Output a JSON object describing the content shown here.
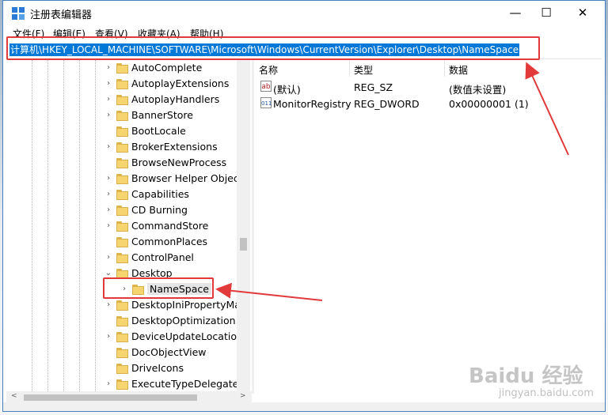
{
  "window": {
    "title": "注册表编辑器",
    "minimize_label": "—",
    "maximize_label": "☐",
    "close_label": "✕"
  },
  "menu": [
    "文件(F)",
    "编辑(E)",
    "查看(V)",
    "收藏夹(A)",
    "帮助(H)"
  ],
  "address": "计算机\\HKEY_LOCAL_MACHINE\\SOFTWARE\\Microsoft\\Windows\\CurrentVersion\\Explorer\\Desktop\\NameSpace",
  "tree": [
    {
      "label": "AutoComplete",
      "expander": ">"
    },
    {
      "label": "AutoplayExtensions",
      "expander": ">"
    },
    {
      "label": "AutoplayHandlers",
      "expander": ">"
    },
    {
      "label": "BannerStore",
      "expander": ">"
    },
    {
      "label": "BootLocale",
      "expander": ""
    },
    {
      "label": "BrokerExtensions",
      "expander": ">"
    },
    {
      "label": "BrowseNewProcess",
      "expander": ""
    },
    {
      "label": "Browser Helper Object",
      "expander": ">"
    },
    {
      "label": "Capabilities",
      "expander": ">"
    },
    {
      "label": "CD Burning",
      "expander": ">"
    },
    {
      "label": "CommandStore",
      "expander": ">"
    },
    {
      "label": "CommonPlaces",
      "expander": ""
    },
    {
      "label": "ControlPanel",
      "expander": ">"
    },
    {
      "label": "Desktop",
      "expander": "v"
    },
    {
      "label": "NameSpace",
      "expander": ">"
    },
    {
      "label": "DesktopIniPropertyMa",
      "expander": ">"
    },
    {
      "label": "DesktopOptimization",
      "expander": ""
    },
    {
      "label": "DeviceUpdateLocations",
      "expander": ">"
    },
    {
      "label": "DocObjectView",
      "expander": ""
    },
    {
      "label": "DriveIcons",
      "expander": ""
    },
    {
      "label": "ExecuteTypeDelegates",
      "expander": ">"
    }
  ],
  "list": {
    "headers": [
      "名称",
      "类型",
      "数据"
    ],
    "rows": [
      {
        "icon": "string-value-icon",
        "icon_text": "ab",
        "name": "(默认)",
        "type": "REG_SZ",
        "data": "(数值未设置)"
      },
      {
        "icon": "binary-value-icon",
        "icon_text": "011",
        "name": "MonitorRegistry",
        "type": "REG_DWORD",
        "data": "0x00000001 (1)"
      }
    ]
  },
  "scrollbar": {
    "left_arrow": "<",
    "right_arrow": ">"
  },
  "colors": {
    "selection": "#0078d7",
    "annotation": "#e23a3a",
    "folder": "#f6d46f"
  },
  "watermark": {
    "text": "Baidu 经验",
    "sub": "jingyan.baidu.com"
  }
}
